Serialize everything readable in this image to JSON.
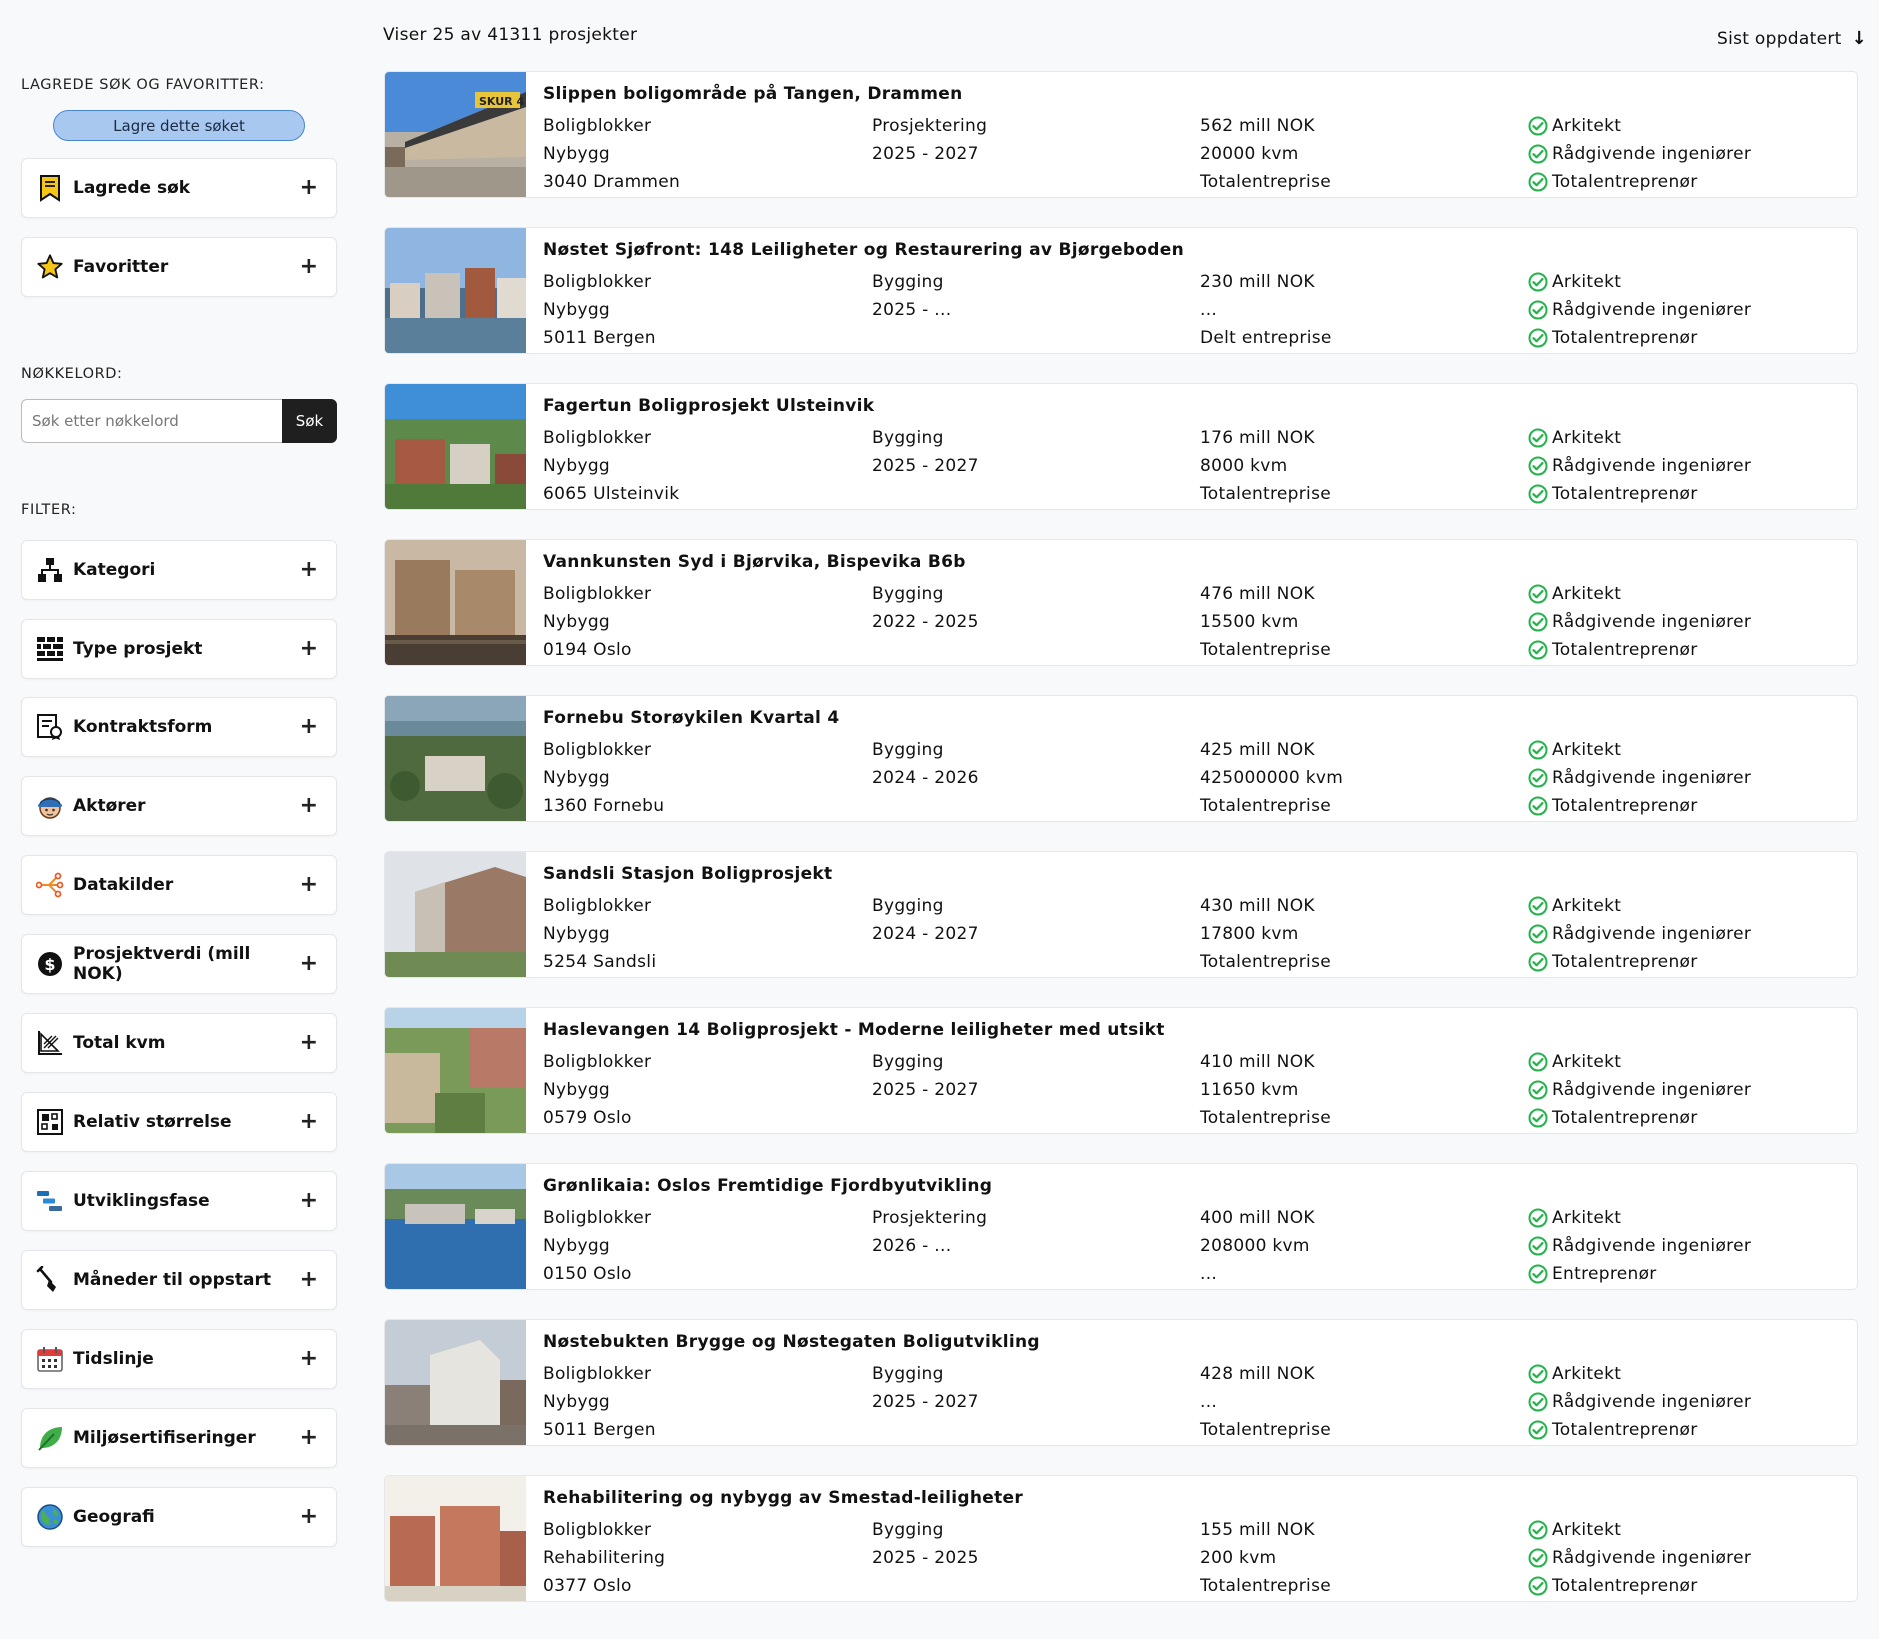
{
  "sidebar": {
    "saved_label": "LAGREDE SØK OG FAVORITTER:",
    "save_search_button": "Lagre dette søket",
    "saved_panels": [
      {
        "label": "Lagrede søk",
        "icon": "bookmark-icon"
      },
      {
        "label": "Favoritter",
        "icon": "star-icon"
      }
    ],
    "keyword_label": "NØKKELORD:",
    "search": {
      "placeholder": "Søk etter nøkkelord",
      "value": "",
      "button": "Søk"
    },
    "filter_label": "FILTER:",
    "filters": [
      {
        "label": "Kategori",
        "icon": "hierarchy-icon"
      },
      {
        "label": "Type prosjekt",
        "icon": "brick-wall-icon"
      },
      {
        "label": "Kontraktsform",
        "icon": "contract-certificate-icon"
      },
      {
        "label": "Aktører",
        "icon": "worker-icon"
      },
      {
        "label": "Datakilder",
        "icon": "data-source-icon"
      },
      {
        "label": "Prosjektverdi (mill NOK)",
        "icon": "dollar-icon"
      },
      {
        "label": "Total kvm",
        "icon": "area-icon"
      },
      {
        "label": "Relativ størrelse",
        "icon": "size-grid-icon"
      },
      {
        "label": "Utviklingsfase",
        "icon": "phase-bars-icon"
      },
      {
        "label": "Måneder til oppstart",
        "icon": "shovel-icon"
      },
      {
        "label": "Tidslinje",
        "icon": "calendar-icon"
      },
      {
        "label": "Miljøsertifiseringer",
        "icon": "leaf-icon"
      },
      {
        "label": "Geografi",
        "icon": "globe-icon"
      }
    ]
  },
  "main": {
    "results_text": "Viser 25 av 41311 prosjekter",
    "sort_label": "Sist oppdatert",
    "sort_icon": "arrow-down-icon",
    "colors": {
      "check": "#22b24c",
      "save_button": "#a8c8f0"
    },
    "projects": [
      {
        "title": "Slippen boligområde på Tangen, Drammen",
        "type": "Boligblokker",
        "build": "Nybygg",
        "location": "3040 Drammen",
        "phase": "Prosjektering",
        "period": "2025 - 2027",
        "value": "562 mill NOK",
        "area": "20000 kvm",
        "contract": "Totalentreprise",
        "roles": [
          "Arkitekt",
          "Rådgivende ingeniører",
          "Totalentreprenør"
        ]
      },
      {
        "title": "Nøstet Sjøfront: 148 Leiligheter og Restaurering av Bjørgeboden",
        "type": "Boligblokker",
        "build": "Nybygg",
        "location": "5011 Bergen",
        "phase": "Bygging",
        "period": "2025 - ...",
        "value": "230 mill NOK",
        "area": "...",
        "contract": "Delt entreprise",
        "roles": [
          "Arkitekt",
          "Rådgivende ingeniører",
          "Totalentreprenør"
        ]
      },
      {
        "title": "Fagertun Boligprosjekt Ulsteinvik",
        "type": "Boligblokker",
        "build": "Nybygg",
        "location": "6065 Ulsteinvik",
        "phase": "Bygging",
        "period": "2025 - 2027",
        "value": "176 mill NOK",
        "area": "8000 kvm",
        "contract": "Totalentreprise",
        "roles": [
          "Arkitekt",
          "Rådgivende ingeniører",
          "Totalentreprenør"
        ]
      },
      {
        "title": "Vannkunsten Syd i Bjørvika, Bispevika B6b",
        "type": "Boligblokker",
        "build": "Nybygg",
        "location": "0194 Oslo",
        "phase": "Bygging",
        "period": "2022 - 2025",
        "value": "476 mill NOK",
        "area": "15500 kvm",
        "contract": "Totalentreprise",
        "roles": [
          "Arkitekt",
          "Rådgivende ingeniører",
          "Totalentreprenør"
        ]
      },
      {
        "title": "Fornebu Storøykilen Kvartal 4",
        "type": "Boligblokker",
        "build": "Nybygg",
        "location": "1360 Fornebu",
        "phase": "Bygging",
        "period": "2024 - 2026",
        "value": "425 mill NOK",
        "area": "425000000 kvm",
        "contract": "Totalentreprise",
        "roles": [
          "Arkitekt",
          "Rådgivende ingeniører",
          "Totalentreprenør"
        ]
      },
      {
        "title": "Sandsli Stasjon Boligprosjekt",
        "type": "Boligblokker",
        "build": "Nybygg",
        "location": "5254 Sandsli",
        "phase": "Bygging",
        "period": "2024 - 2027",
        "value": "430 mill NOK",
        "area": "17800 kvm",
        "contract": "Totalentreprise",
        "roles": [
          "Arkitekt",
          "Rådgivende ingeniører",
          "Totalentreprenør"
        ]
      },
      {
        "title": "Haslevangen 14 Boligprosjekt - Moderne leiligheter med utsikt",
        "type": "Boligblokker",
        "build": "Nybygg",
        "location": "0579 Oslo",
        "phase": "Bygging",
        "period": "2025 - 2027",
        "value": "410 mill NOK",
        "area": "11650 kvm",
        "contract": "Totalentreprise",
        "roles": [
          "Arkitekt",
          "Rådgivende ingeniører",
          "Totalentreprenør"
        ]
      },
      {
        "title": "Grønlikaia: Oslos Fremtidige Fjordbyutvikling",
        "type": "Boligblokker",
        "build": "Nybygg",
        "location": "0150 Oslo",
        "phase": "Prosjektering",
        "period": "2026 - ...",
        "value": "400 mill NOK",
        "area": "208000 kvm",
        "contract": "...",
        "roles": [
          "Arkitekt",
          "Rådgivende ingeniører",
          "Entreprenør"
        ]
      },
      {
        "title": "Nøstebukten Brygge og Nøstegaten Boligutvikling",
        "type": "Boligblokker",
        "build": "Nybygg",
        "location": "5011 Bergen",
        "phase": "Bygging",
        "period": "2025 - 2027",
        "value": "428 mill NOK",
        "area": "...",
        "contract": "Totalentreprise",
        "roles": [
          "Arkitekt",
          "Rådgivende ingeniører",
          "Totalentreprenør"
        ]
      },
      {
        "title": "Rehabilitering og nybygg av Smestad-leiligheter",
        "type": "Boligblokker",
        "build": "Rehabilitering",
        "location": "0377 Oslo",
        "phase": "Bygging",
        "period": "2025 - 2025",
        "value": "155 mill NOK",
        "area": "200 kvm",
        "contract": "Totalentreprise",
        "roles": [
          "Arkitekt",
          "Rådgivende ingeniører",
          "Totalentreprenør"
        ]
      }
    ]
  }
}
